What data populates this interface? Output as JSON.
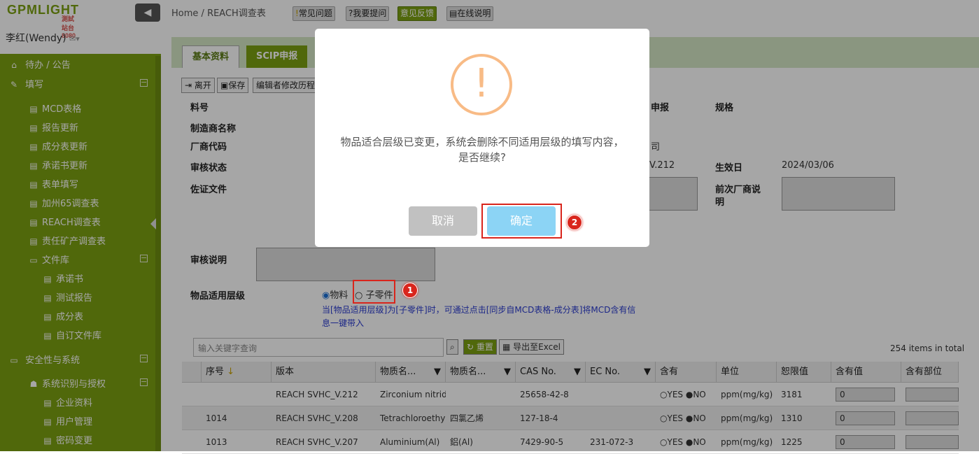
{
  "logo": {
    "brand": "GPMLIGHT",
    "sub": "測試站台8080"
  },
  "user": {
    "name": "李红(Wendy)",
    "mail_icon": "mail-icon"
  },
  "sidebar": {
    "items": [
      {
        "label": "待办 / 公告",
        "icon": "home-icon"
      },
      {
        "label": "填写",
        "icon": "edit-icon"
      },
      {
        "label": "MCD表格"
      },
      {
        "label": "报告更新"
      },
      {
        "label": "成分表更新"
      },
      {
        "label": "承诺书更新"
      },
      {
        "label": "表单填写"
      },
      {
        "label": "加州65调查表"
      },
      {
        "label": "REACH调查表"
      },
      {
        "label": "责任矿产调查表"
      },
      {
        "label": "文件库",
        "icon": "folder-icon"
      },
      {
        "label": "承诺书"
      },
      {
        "label": "测试报告"
      },
      {
        "label": "成分表"
      },
      {
        "label": "自订文件库"
      },
      {
        "label": "安全性与系统",
        "icon": "monitor-icon"
      },
      {
        "label": "系统识别与授权",
        "icon": "users-icon"
      },
      {
        "label": "企业资料"
      },
      {
        "label": "用户管理"
      },
      {
        "label": "密码变更"
      }
    ]
  },
  "breadcrumb": {
    "home": "Home",
    "sep": "/",
    "current": "REACH调查表"
  },
  "toolbar": {
    "faq": "常见问题",
    "ask": "?我要提问",
    "feedback": "意见反馈",
    "help": "在线说明"
  },
  "tabs": {
    "basic": "基本资料",
    "scip": "SCIP申报"
  },
  "actions": {
    "leave": "离开",
    "save": "保存",
    "history": "编辑者修改历程"
  },
  "form": {
    "part_no": "料号",
    "maker": "制造商名称",
    "vendor_code": "厂商代码",
    "review_status": "审核状态",
    "evidence": "佐证文件",
    "review_note": "审核说明",
    "level": "物品适用层级",
    "declare_frag": "申报",
    "spec": "规格",
    "company_frag": "司",
    "version_frag": "V.212",
    "effective_label": "生效日",
    "effective_value": "2024/03/06",
    "prev_note_label": "前次厂商说",
    "prev_note_label2": "明",
    "level_opt1": "物料",
    "level_opt2": "子零件",
    "hint": "当[物品适用层级]为[子零件]时，可通过点击[同步自MCD表格-成分表]将MCD含有信息一键带入"
  },
  "grid_tools": {
    "search_placeholder": "输入关键字查询",
    "reset": "重置",
    "export": "导出至Excel",
    "count": "254 items in total"
  },
  "grid": {
    "headers": [
      "序号",
      "版本",
      "物质名...",
      "物质名...",
      "CAS No.",
      "EC No.",
      "含有",
      "单位",
      "恕限值",
      "含有值",
      "含有部位"
    ],
    "rows": [
      {
        "no": "",
        "version": "REACH SVHC_V.212",
        "name_en": "Zirconium nitride",
        "name_cn": "",
        "cas": "25658-42-8",
        "ec": "",
        "yes": "YES",
        "no_opt": "NO",
        "unit": "ppm(mg/kg)",
        "limit": "3181",
        "value": "0"
      },
      {
        "no": "1014",
        "version": "REACH SVHC_V.208",
        "name_en": "Tetrachloroethyl",
        "name_cn": "四氯乙烯",
        "cas": "127-18-4",
        "ec": "",
        "yes": "YES",
        "no_opt": "NO",
        "unit": "ppm(mg/kg)",
        "limit": "1310",
        "value": "0"
      },
      {
        "no": "1013",
        "version": "REACH SVHC_V.207",
        "name_en": "Aluminium(Al)",
        "name_cn": "鋁(Al)",
        "cas": "7429-90-5",
        "ec": "231-072-3",
        "yes": "YES",
        "no_opt": "NO",
        "unit": "ppm(mg/kg)",
        "limit": "1225",
        "value": "0"
      }
    ]
  },
  "modal": {
    "line1": "物品适合层级已变更，系统会删除不同适用层级的填写内容，",
    "line2": "是否继续?",
    "cancel": "取消",
    "ok": "确定",
    "icon": "warning-icon"
  },
  "annotations": {
    "badge1": "1",
    "badge2": "2"
  }
}
